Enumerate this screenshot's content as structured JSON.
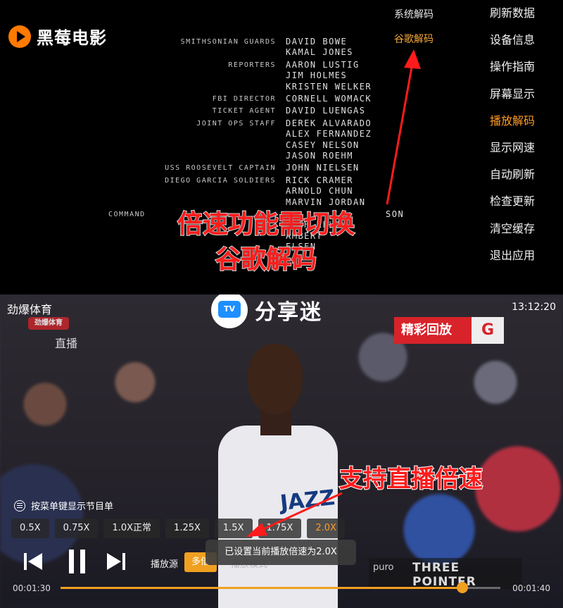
{
  "app": {
    "name": "黑莓电影"
  },
  "credits": [
    {
      "role": "SMITHSONIAN GUARDS",
      "names": [
        "DAVID BOWE",
        "KAMAL JONES"
      ]
    },
    {
      "role": "REPORTERS",
      "names": [
        "AARON LUSTIG",
        "JIM HOLMES",
        "KRISTEN WELKER"
      ]
    },
    {
      "role": "FBI DIRECTOR",
      "names": [
        "CORNELL WOMACK"
      ]
    },
    {
      "role": "TICKET AGENT",
      "names": [
        "DAVID LUENGAS"
      ]
    },
    {
      "role": "JOINT OPS STAFF",
      "names": [
        "DEREK ALVARADO",
        "ALEX FERNANDEZ",
        "CASEY NELSON",
        "JASON ROEHM"
      ]
    },
    {
      "role": "USS ROOSEVELT CAPTAIN",
      "names": [
        "JOHN NIELSEN"
      ]
    },
    {
      "role": "DIEGO GARCIA SOLDIERS",
      "names": [
        "RICK CRAMER",
        "ARNOLD CHUN",
        "MARVIN JORDAN"
      ]
    },
    {
      "role": "COMMAND",
      "names": [
        "SON",
        "JOSH KELLY",
        "AMBERT",
        "ELSEN"
      ]
    }
  ],
  "decode_options": {
    "system": "系统解码",
    "google": "谷歌解码"
  },
  "side_menu": {
    "items": [
      "刷新数据",
      "设备信息",
      "操作指南",
      "屏幕显示",
      "播放解码",
      "显示网速",
      "自动刷新",
      "检查更新",
      "清空缓存",
      "退出应用"
    ],
    "active_index": 4
  },
  "annotations": {
    "top_line1": "倍速功能需切换",
    "top_line2": "谷歌解码",
    "bottom": "支持直播倍速"
  },
  "watermark": {
    "tv_label": "TV",
    "text": "分享迷"
  },
  "player": {
    "channel_name": "劲爆体育",
    "channel_logo": "劲爆体育",
    "live_tag": "直播",
    "clock": "13:12:20",
    "replay_label": "精彩回放",
    "jersey_text": "JAZZ",
    "menu_hint": "按菜单键显示节目单",
    "speeds": [
      "0.5X",
      "0.75X",
      "1.0X正常",
      "1.25X",
      "1.5X",
      "1.75X",
      "2.0X"
    ],
    "selected_speed_index": 6,
    "source_label": "播放源",
    "source_value": "多倍",
    "mode_label": "播放模式",
    "toast": "已设置当前播放倍速为2.0X",
    "scoreboard_brand": "puro",
    "scoreboard_title": "THREE POINTER",
    "time_current": "00:01:30",
    "time_total": "00:01:40",
    "progress": 0.914
  },
  "colors": {
    "accent": "#f0a020",
    "active_menu": "#ff9b27",
    "callout": "#ff1b1b"
  }
}
